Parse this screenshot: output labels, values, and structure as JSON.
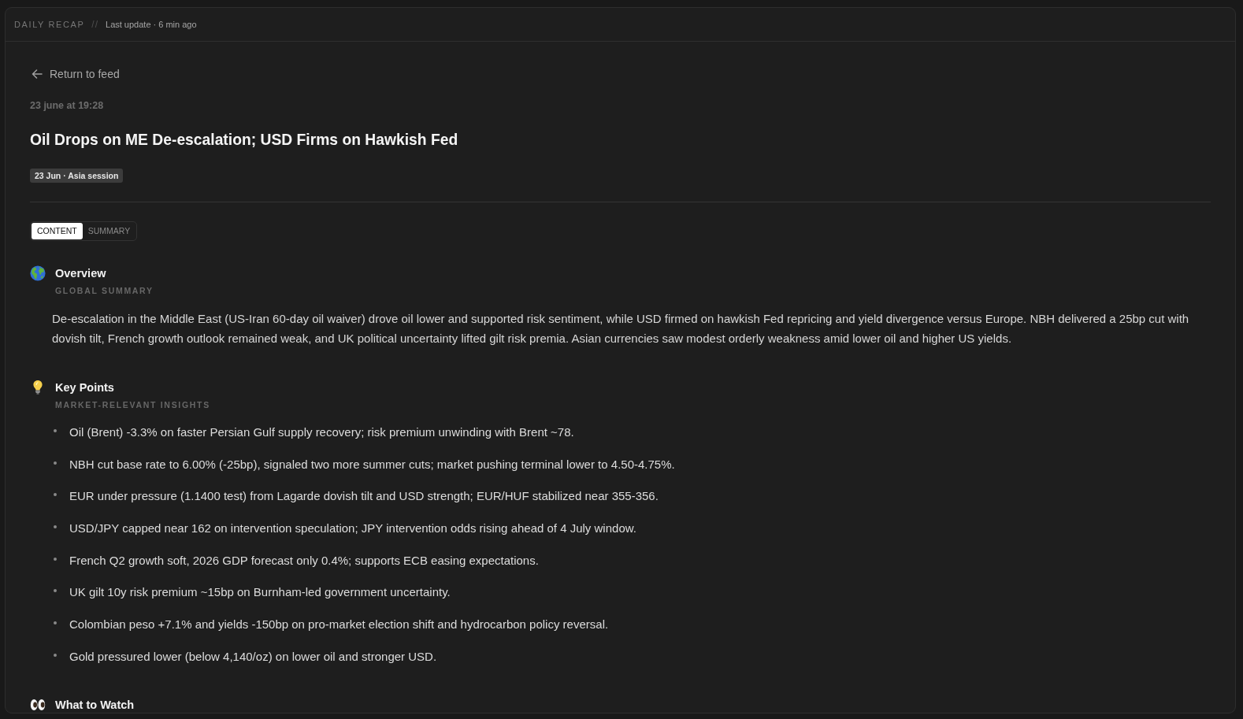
{
  "header": {
    "title": "DAILY RECAP",
    "separator": "//",
    "last_update": "Last update · 6 min ago"
  },
  "back_link": {
    "label": "Return to feed"
  },
  "date": "23 june at 19:28",
  "title": "Oil Drops on ME De-escalation; USD Firms on Hawkish Fed",
  "tag": "23 Jun · Asia session",
  "tabs": [
    {
      "label": "CONTENT",
      "selected": true
    },
    {
      "label": "SUMMARY",
      "selected": false
    }
  ],
  "sections": [
    {
      "kind": "paragraph",
      "heading": "Overview",
      "subtitle": "GLOBAL SUMMARY",
      "text": "De-escalation in the Middle East (US-Iran 60-day oil waiver) drove oil lower and supported risk sentiment, while USD firmed on hawkish Fed repricing and yield divergence versus Europe. NBH delivered a 25bp cut with dovish tilt, French growth outlook remained weak, and UK political uncertainty lifted gilt risk premia. Asian currencies saw modest orderly weakness amid lower oil and higher US yields."
    },
    {
      "kind": "list",
      "heading": "Key Points",
      "subtitle": "MARKET-RELEVANT INSIGHTS",
      "items": [
        "Oil (Brent) -3.3% on faster Persian Gulf supply recovery; risk premium unwinding with Brent ~78.",
        "NBH cut base rate to 6.00% (-25bp), signaled two more summer cuts; market pushing terminal lower to 4.50-4.75%.",
        "EUR under pressure (1.1400 test) from Lagarde dovish tilt and USD strength; EUR/HUF stabilized near 355-356.",
        "USD/JPY capped near 162 on intervention speculation; JPY intervention odds rising ahead of 4 July window.",
        "French Q2 growth soft, 2026 GDP forecast only 0.4%; supports ECB easing expectations.",
        "UK gilt 10y risk premium ~15bp on Burnham-led government uncertainty.",
        "Colombian peso +7.1% and yields -150bp on pro-market election shift and hydrocarbon policy reversal.",
        "Gold pressured lower (below 4,140/oz) on lower oil and stronger USD."
      ]
    },
    {
      "kind": "heading",
      "heading": "What to Watch"
    }
  ]
}
